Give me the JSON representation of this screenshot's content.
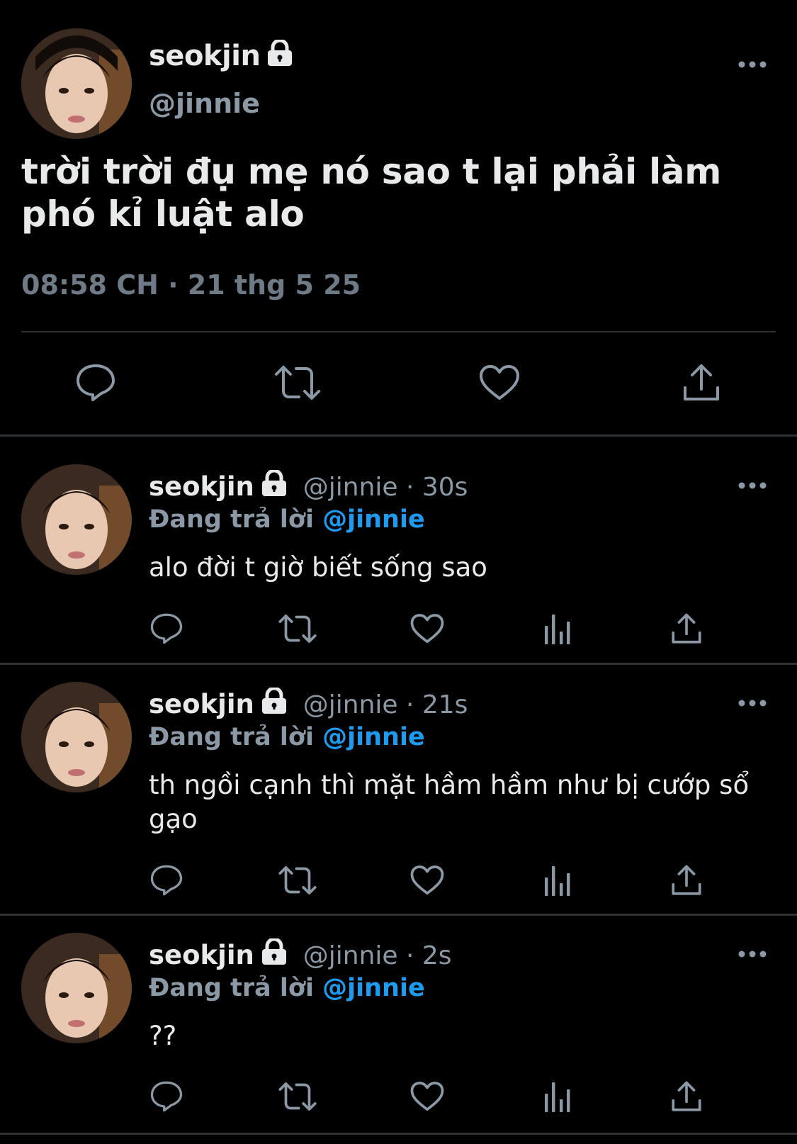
{
  "main_tweet": {
    "display_name": "seokjin",
    "handle": "@jinnie",
    "text": "trời trời đụ mẹ nó sao t lại phải làm phó kỉ luật alo",
    "timestamp": "08:58 CH · 21 thg 5 25",
    "actions": [
      "reply-icon",
      "retweet-icon",
      "like-icon",
      "share-icon"
    ]
  },
  "replies": [
    {
      "display_name": "seokjin",
      "handle_time": "@jinnie · 30s",
      "replying_prefix": "Đang trả lời",
      "replying_to": "@jinnie",
      "text": "alo đời t giờ biết sống sao"
    },
    {
      "display_name": "seokjin",
      "handle_time": "@jinnie · 21s",
      "replying_prefix": "Đang trả lời",
      "replying_to": "@jinnie",
      "text": "th ngồi cạnh thì mặt hầm hầm như bị cướp sổ gạo"
    },
    {
      "display_name": "seokjin",
      "handle_time": "@jinnie · 2s",
      "replying_prefix": "Đang trả lời",
      "replying_to": "@jinnie",
      "text": "??"
    }
  ],
  "colors": {
    "background": "#000000",
    "text": "#e7e9ea",
    "secondary": "#8b98a5",
    "mention": "#1d9bf0",
    "divider": "#2f3336"
  }
}
